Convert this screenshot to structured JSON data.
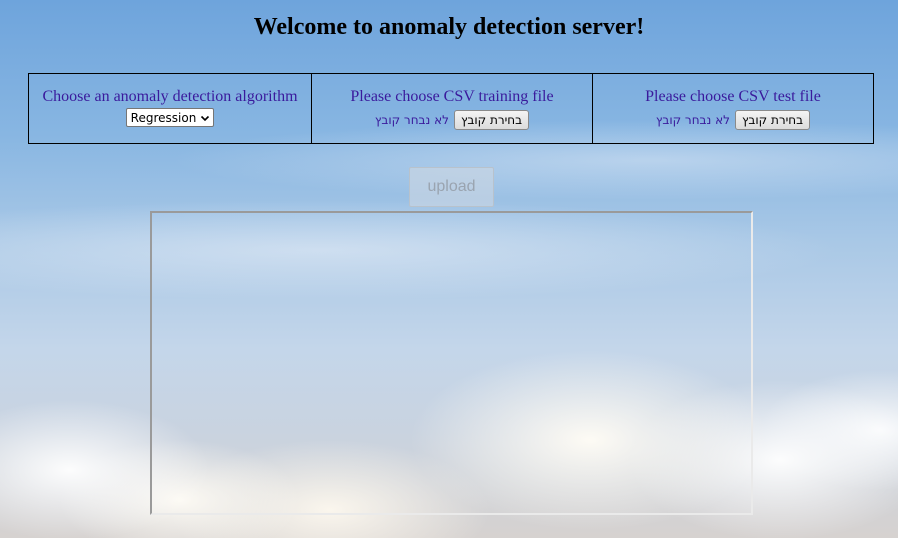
{
  "page": {
    "title": "Welcome to anomaly detection server!"
  },
  "algorithm": {
    "label": "Choose an anomaly detection algorithm",
    "selected": "Regression"
  },
  "training": {
    "label": "Please choose CSV training file",
    "button": "בחירת קובץ",
    "status": "לא נבחר קובץ"
  },
  "test": {
    "label": "Please choose CSV test file",
    "button": "בחירת קובץ",
    "status": "לא נבחר קובץ"
  },
  "upload": {
    "label": "upload",
    "disabled": true
  },
  "colors": {
    "label_text": "#3a1a9c",
    "title_text": "#000000",
    "panel_border": "#000000"
  },
  "icons": {
    "select_arrow": "chevron-down-icon"
  }
}
